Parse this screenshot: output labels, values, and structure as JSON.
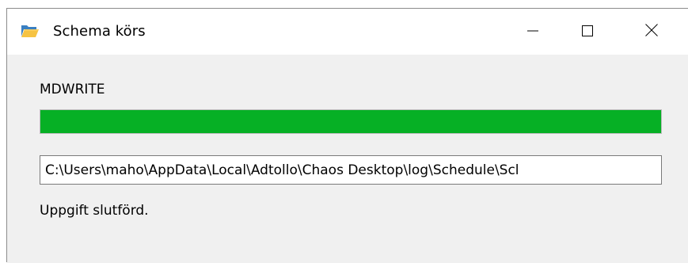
{
  "window": {
    "title": "Schema körs",
    "controls": {
      "minimize_icon": "minimize-icon",
      "maximize_icon": "maximize-icon",
      "close_icon": "close-icon"
    },
    "app_icon": "folder-icon"
  },
  "job": {
    "name": "MDWRITE",
    "progress": 1.0,
    "progress_color": "#06b025",
    "log_path": "C:\\Users\\maho\\AppData\\Local\\Adtollo\\Chaos Desktop\\log\\Schedule\\Scl",
    "status": "Uppgift slutförd."
  }
}
